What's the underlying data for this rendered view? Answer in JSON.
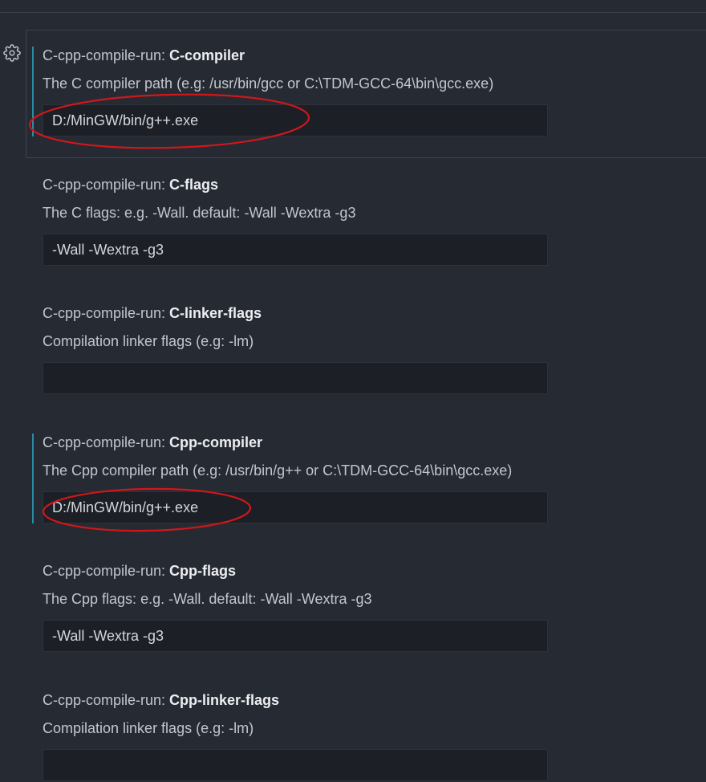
{
  "settings": [
    {
      "category": "C-cpp-compile-run: ",
      "key": "C-compiler",
      "description": "The C compiler path (e.g: /usr/bin/gcc or C:\\TDM-GCC-64\\bin\\gcc.exe)",
      "value": "D:/MinGW/bin/g++.exe",
      "modified": true,
      "focused": true
    },
    {
      "category": "C-cpp-compile-run: ",
      "key": "C-flags",
      "description": "The C flags: e.g. -Wall. default: -Wall -Wextra -g3",
      "value": "-Wall -Wextra -g3",
      "modified": false,
      "focused": false
    },
    {
      "category": "C-cpp-compile-run: ",
      "key": "C-linker-flags",
      "description": "Compilation linker flags (e.g: -lm)",
      "value": "",
      "modified": false,
      "focused": false
    },
    {
      "category": "C-cpp-compile-run: ",
      "key": "Cpp-compiler",
      "description": "The Cpp compiler path (e.g: /usr/bin/g++ or C:\\TDM-GCC-64\\bin\\gcc.exe)",
      "value": "D:/MinGW/bin/g++.exe",
      "modified": true,
      "focused": false
    },
    {
      "category": "C-cpp-compile-run: ",
      "key": "Cpp-flags",
      "description": "The Cpp flags: e.g. -Wall. default: -Wall -Wextra -g3",
      "value": "-Wall -Wextra -g3",
      "modified": false,
      "focused": false
    },
    {
      "category": "C-cpp-compile-run: ",
      "key": "Cpp-linker-flags",
      "description": "Compilation linker flags (e.g: -lm)",
      "value": "",
      "modified": false,
      "focused": false
    }
  ],
  "icons": {
    "settings_gear": "gear-icon"
  },
  "colors": {
    "background": "#262a33",
    "input_background": "#1c1f26",
    "modified_indicator": "#2b8ba7",
    "annotation_ellipse": "#d0171b",
    "title_key": "#eceef1",
    "text": "#c3c6cc"
  }
}
